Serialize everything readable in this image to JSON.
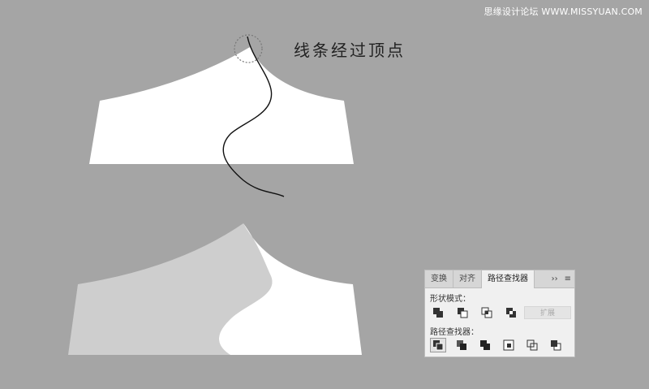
{
  "watermark": "思缘设计论坛 WWW.MISSYUAN.COM",
  "annotation": "线条经过顶点",
  "colors": {
    "canvas_bg": "#a5a5a5",
    "shape_white": "#ffffff",
    "shape_gray": "#cecece",
    "line": "#111111",
    "dashed_circle": "#888888"
  },
  "pathfinder_panel": {
    "tabs": [
      {
        "label": "变换",
        "active": false
      },
      {
        "label": "对齐",
        "active": false
      },
      {
        "label": "路径查找器",
        "active": true
      }
    ],
    "overflow_glyph": "››",
    "menu_glyph": "≡",
    "shape_modes_label": "形状模式：",
    "shape_modes": [
      {
        "icon": "unite-icon"
      },
      {
        "icon": "minus-front-icon"
      },
      {
        "icon": "intersect-icon"
      },
      {
        "icon": "exclude-icon"
      }
    ],
    "expand_label": "扩展",
    "pathfinders_label": "路径查找器：",
    "pathfinders": [
      {
        "icon": "divide-icon",
        "selected": true
      },
      {
        "icon": "trim-icon",
        "selected": false
      },
      {
        "icon": "merge-icon",
        "selected": false
      },
      {
        "icon": "crop-icon",
        "selected": false
      },
      {
        "icon": "outline-icon",
        "selected": false
      },
      {
        "icon": "minus-back-icon",
        "selected": false
      }
    ]
  }
}
